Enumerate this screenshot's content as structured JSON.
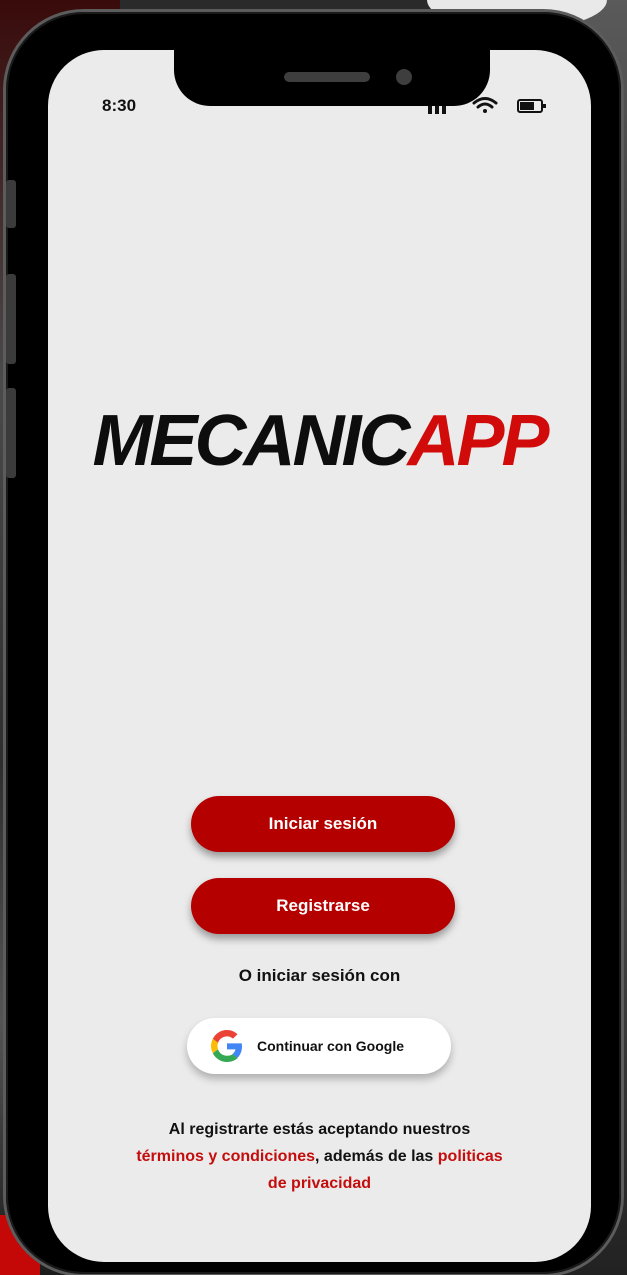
{
  "status_bar": {
    "time": "8:30"
  },
  "logo": {
    "part1": "MECANIC",
    "part2": "APP"
  },
  "buttons": {
    "login": "Iniciar sesión",
    "register": "Registrarse"
  },
  "alt_login": {
    "text": "O iniciar sesión con"
  },
  "google": {
    "label": "Continuar con Google"
  },
  "terms": {
    "line1": "Al registrarte estás aceptando nuestros",
    "terms_link": "términos y condiciones",
    "middle": ", además de las ",
    "privacy_link_1": "politicas",
    "privacy_link_2": "de privacidad"
  },
  "colors": {
    "accent": "#b50000",
    "logo_red": "#d10a0a",
    "screen_bg": "#ebebeb"
  },
  "icons": [
    "signal-icon",
    "wifi-icon",
    "battery-icon",
    "google-icon"
  ]
}
